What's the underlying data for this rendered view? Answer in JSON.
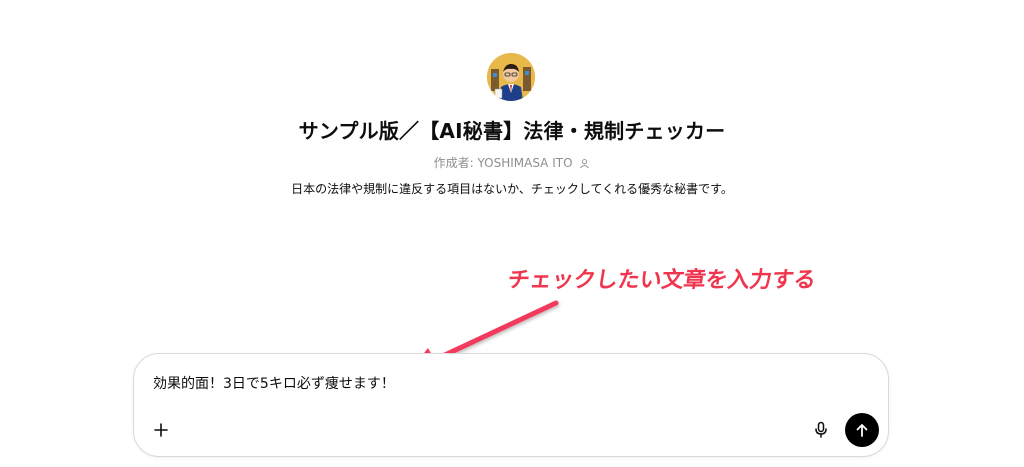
{
  "gpt": {
    "title": "サンプル版／【AI秘書】法律・規制チェッカー",
    "author": "作成者: YOSHIMASA ITO",
    "description": "日本の法律や規制に違反する項目はないか、チェックしてくれる優秀な秘書です。"
  },
  "annotation": {
    "text": "チェックしたい文章を入力する",
    "color": "#f0364e"
  },
  "composer": {
    "value": "効果的面！3日で5キロ必ず痩せます！",
    "attach_icon": "plus-icon",
    "mic_icon": "microphone-icon",
    "send_icon": "arrow-up-icon"
  }
}
